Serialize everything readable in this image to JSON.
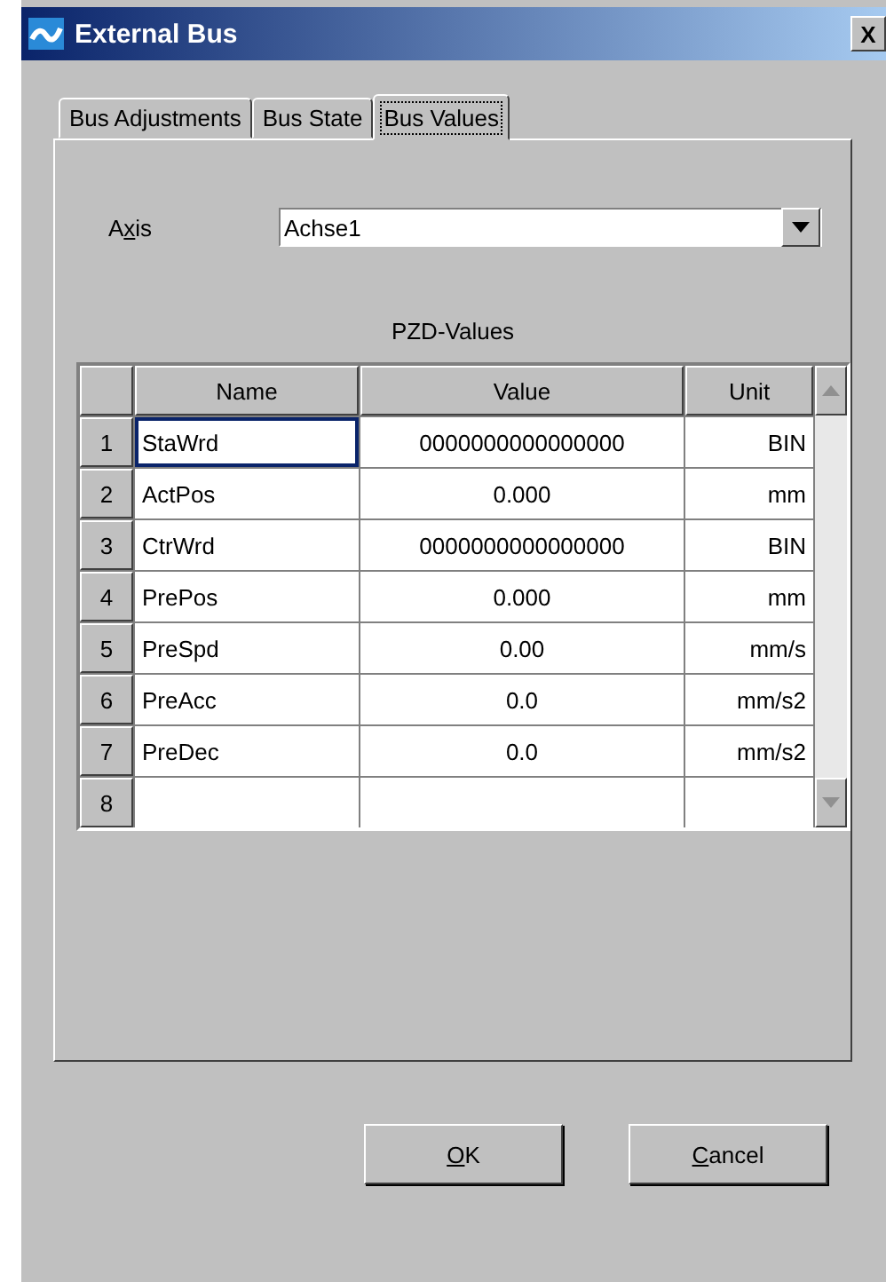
{
  "window": {
    "title": "External Bus",
    "close": "X"
  },
  "tabs": [
    {
      "label": "Bus Adjustments",
      "selected": false
    },
    {
      "label": "Bus State",
      "selected": false
    },
    {
      "label": "Bus Values",
      "selected": true
    }
  ],
  "axis": {
    "label": {
      "before": "A",
      "key": "x",
      "after": "is"
    },
    "value": "Achse1"
  },
  "table": {
    "title": "PZD-Values",
    "columns": [
      "Name",
      "Value",
      "Unit"
    ],
    "rows": [
      {
        "number": "1",
        "name": "StaWrd",
        "value": "0000000000000000",
        "unit": "BIN",
        "selected": true
      },
      {
        "number": "2",
        "name": "ActPos",
        "value": "0.000",
        "unit": "mm",
        "selected": false
      },
      {
        "number": "3",
        "name": "CtrWrd",
        "value": "0000000000000000",
        "unit": "BIN",
        "selected": false
      },
      {
        "number": "4",
        "name": "PrePos",
        "value": "0.000",
        "unit": "mm",
        "selected": false
      },
      {
        "number": "5",
        "name": "PreSpd",
        "value": "0.00",
        "unit": "mm/s",
        "selected": false
      },
      {
        "number": "6",
        "name": "PreAcc",
        "value": "0.0",
        "unit": "mm/s2",
        "selected": false
      },
      {
        "number": "7",
        "name": "PreDec",
        "value": "0.0",
        "unit": "mm/s2",
        "selected": false
      },
      {
        "number": "8",
        "selected": false
      }
    ]
  },
  "buttons": [
    {
      "label": {
        "key": "O",
        "after": "K"
      }
    },
    {
      "label": {
        "key": "C",
        "after": "ancel"
      }
    }
  ]
}
